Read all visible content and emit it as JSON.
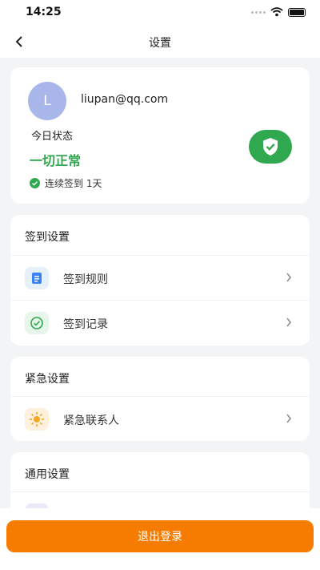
{
  "status_bar": {
    "time": "14:25"
  },
  "nav": {
    "title": "设置"
  },
  "profile": {
    "avatar_letter": "L",
    "email": "liupan@qq.com",
    "today_label": "今日状态",
    "status": "一切正常",
    "streak": "连续签到 1天"
  },
  "checkin_section": {
    "title": "签到设置",
    "items": [
      {
        "label": "签到规则",
        "icon": "document-icon"
      },
      {
        "label": "签到记录",
        "icon": "check-circle-icon"
      }
    ]
  },
  "emergency_section": {
    "title": "紧急设置",
    "items": [
      {
        "label": "紧急联系人",
        "icon": "sun-icon"
      }
    ]
  },
  "general_section": {
    "title": "通用设置"
  },
  "logout_label": "退出登录",
  "colors": {
    "accent": "#f57c00",
    "success": "#2fa84f",
    "avatar": "#a9b6ea"
  }
}
